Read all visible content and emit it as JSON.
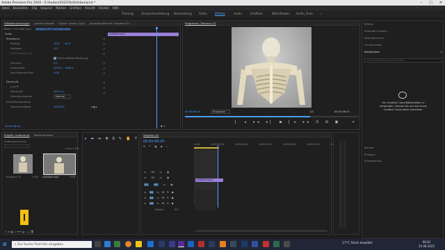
{
  "window": {
    "title": "Adobe Premiere Pro 2020 - E:\\Auden\\2022\\Test\\Unbenannt *",
    "controls": [
      "–",
      "□",
      "✕"
    ]
  },
  "menu": [
    "Datei",
    "Bearbeiten",
    "Clip",
    "Sequenz",
    "Marken",
    "Grafiken",
    "Ansicht",
    "Fenster",
    "Hilfe"
  ],
  "workspaces": [
    "Training",
    "Zusammenstellung",
    "Bearbeitung",
    "Farbe",
    "Effekte",
    "Audio",
    "Grafiken",
    "Bibliotheken",
    "Audio_Tune"
  ],
  "active_workspace": "Effekte",
  "effect_controls": {
    "tabs": [
      "Effekteinstellungen",
      "Lumetri-Scopes",
      "Quelle: (keine Clips)",
      "Audioclip-Mischer: Sequenz 01"
    ],
    "clip_path": "Master * schulter.mp4",
    "seq_path": "Sequenz 01 * schulter.mp4",
    "section_video": "Video",
    "clip_name": "schulter.mp4",
    "rows": [
      {
        "label": "Bewegung"
      },
      {
        "label": "Position",
        "v1": "1012",
        "v2": "46.0"
      },
      {
        "label": "Skalieren",
        "v1": "472"
      },
      {
        "label": "Breitenskalierung",
        "v1": ""
      },
      {
        "label": "",
        "check": "Gleichmäßige Skalierung"
      },
      {
        "label": "Drehung",
        "v1": "0,0"
      },
      {
        "label": "Ankerpunkt",
        "v1": "1910,0",
        "v2": "1080,0"
      },
      {
        "label": "Anti-Flimmer-Filter",
        "v1": "0,00"
      },
      {
        "label": "Deckkraft"
      },
      {
        "label": "Deckkraft",
        "v1": "100,0 %"
      },
      {
        "label": "Überblendmodus",
        "v1": "Normal"
      },
      {
        "label": "Zeit-Neuzuordnung"
      },
      {
        "label": "Geschwindigkeit",
        "v1": "100,00%"
      }
    ],
    "timecode": "00:00:06:00"
  },
  "program": {
    "title": "Programm: Sequenz 01",
    "timecode_left": "00:00:06:00",
    "fit": "Einpassen",
    "quality": "1/2",
    "timecode_right": "00:00:06:01"
  },
  "right_panels": {
    "items": [
      "Effekte",
      "Essential Graphics",
      "Essential Sound",
      "Lumetri-Farbe"
    ],
    "libraries_title": "Bibliotheken",
    "search_placeholder": "Alle Bibliotheken durchsuchen",
    "cc_message": "Um Creative Cloud-Bibliotheken zu verwenden, müssen Sie sich bei einem Creative Cloud-Konto anmelden.",
    "bottom_items": [
      "Marken",
      "Protokoll",
      "Informationen"
    ]
  },
  "project": {
    "tabs": [
      "Projekt: Unbenannt",
      "Media-Browser"
    ],
    "file": "Unbenannt.prproj",
    "count": "1 von 2 Ele...",
    "items": [
      {
        "name": "Sequenz 01",
        "dur": "5:00"
      },
      {
        "name": "schulter.mp4",
        "dur": "5:00"
      }
    ]
  },
  "timeline": {
    "tab": "Sequenz 01",
    "timecode": "00:00:06:00",
    "ruler": [
      "00:00",
      "00:00:05:00",
      "00:00:10:00",
      "00:00:15:00",
      "00:00:20:00",
      "00:00:25:00",
      "00:00:30:00"
    ],
    "tracks": [
      "V3",
      "V2",
      "V1",
      "A1",
      "A2",
      "A3"
    ],
    "master": "Master",
    "master_val": "0,0",
    "clip": "schulter.mp4"
  },
  "taskbar": {
    "search_placeholder": "Zur Suche Text hier eingeben",
    "weather": "17°C  Stark bewölkt",
    "time": "08:42",
    "date": "25.08.2022"
  },
  "colors": {
    "accent": "#4a9eff",
    "clip": "#9b7fd9",
    "playhead": "#4a9eff"
  }
}
